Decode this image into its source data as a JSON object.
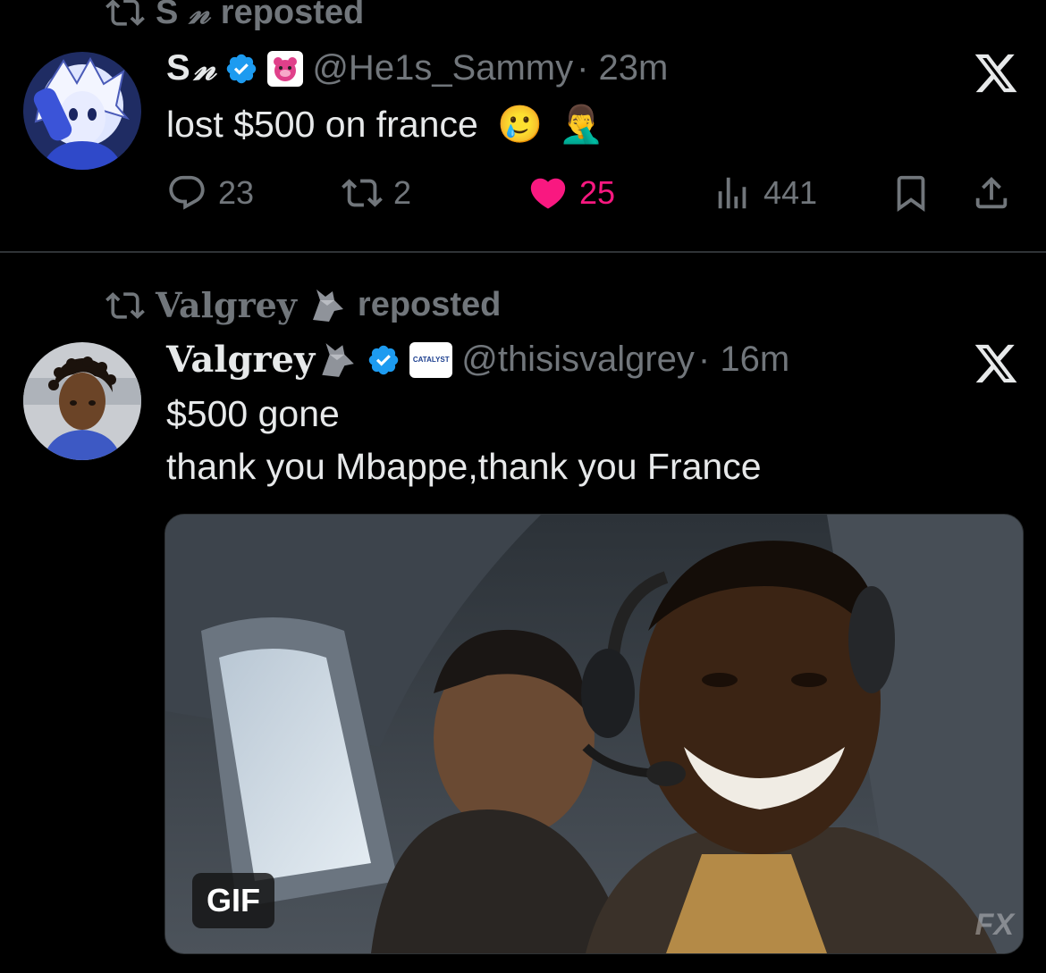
{
  "posts": [
    {
      "repost_by": "S",
      "repost_label": "reposted",
      "name": "S",
      "handle": "@He1s_Sammy",
      "time": "· 23m",
      "text": "lost $500 on france",
      "emoji_1": "🥲",
      "emoji_2": "🤦‍♂️",
      "replies": "23",
      "reposts": "2",
      "likes": "25",
      "views": "441",
      "liked": true
    },
    {
      "repost_by": "Valgrey",
      "repost_label": "reposted",
      "name": "Valgrey",
      "badge_text": "CATALYST",
      "handle": "@thisisvalgrey",
      "time": "· 16m",
      "text_line1": "$500 gone",
      "text_line2": "thank you Mbappe,thank you France",
      "media_badge": "GIF",
      "media_watermark": "FX"
    }
  ],
  "colors": {
    "background": "#000000",
    "text": "#e7e9ea",
    "muted": "#71767b",
    "verified": "#1d9bf0",
    "like": "#f91880"
  }
}
